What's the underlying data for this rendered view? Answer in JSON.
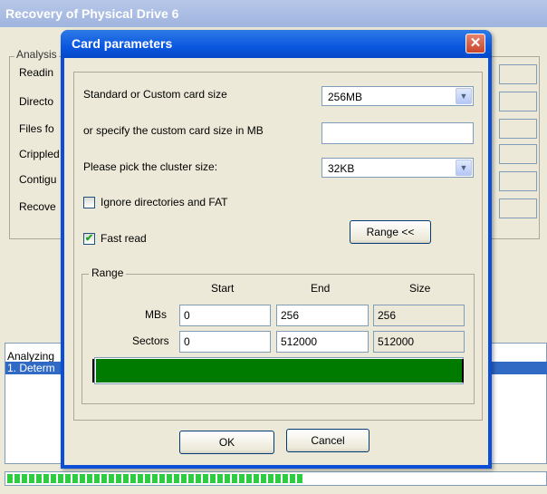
{
  "background_window": {
    "title": "Recovery of Physical Drive 6",
    "group_title": "Analysis",
    "rows": [
      "Readin",
      "Directo",
      "Files fo",
      "Crippled",
      "Contigu",
      "Recove"
    ],
    "log_lines": [
      "Analyzing",
      "1. Determ"
    ],
    "progress_fraction": 0.55
  },
  "dialog": {
    "title": "Card parameters",
    "close_symbol": "✕",
    "card_size_label": "Standard or Custom card size",
    "card_size_value": "256MB",
    "custom_size_label": "or specify the custom card size in MB",
    "custom_size_value": "",
    "cluster_label": "Please pick the cluster size:",
    "cluster_value": "32KB",
    "ignore_dirs_label": "Ignore directories and FAT",
    "ignore_dirs_checked": false,
    "fast_read_label": "Fast read",
    "fast_read_checked": true,
    "range_button": "Range <<",
    "range": {
      "title": "Range",
      "headers": {
        "start": "Start",
        "end": "End",
        "size": "Size"
      },
      "mbs": {
        "label": "MBs",
        "start": "0",
        "end": "256",
        "size": "256"
      },
      "sectors": {
        "label": "Sectors",
        "start": "0",
        "end": "512000",
        "size": "512000"
      }
    },
    "ok_label": "OK",
    "cancel_label": "Cancel"
  },
  "icons": {
    "close": "close-icon",
    "dropdown": "chevron-down-icon",
    "check": "checkmark-icon"
  },
  "colors": {
    "titlebar": "#0a57df",
    "range_fill": "#007b00",
    "progress": "#2ecc40",
    "selection": "#316ac5"
  }
}
